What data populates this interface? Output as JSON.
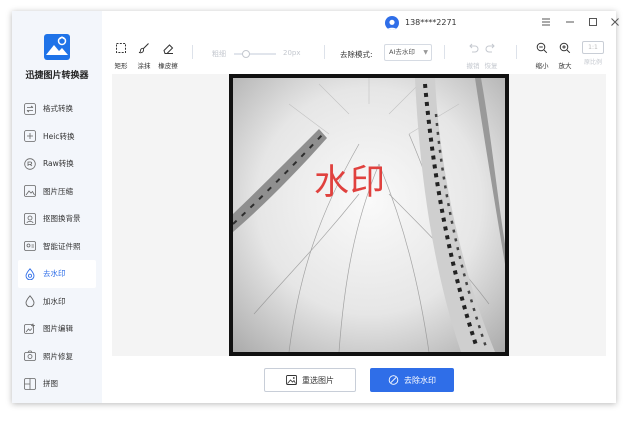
{
  "app": {
    "title": "迅捷图片转换器"
  },
  "nav": {
    "items": [
      {
        "label": "格式转换",
        "icon": "swap-icon"
      },
      {
        "label": "Heic转换",
        "icon": "heic-icon"
      },
      {
        "label": "Raw转换",
        "icon": "raw-icon"
      },
      {
        "label": "图片压缩",
        "icon": "compress-icon"
      },
      {
        "label": "抠图换背景",
        "icon": "cutout-icon"
      },
      {
        "label": "智能证件照",
        "icon": "id-photo-icon"
      },
      {
        "label": "去水印",
        "icon": "remove-watermark-icon",
        "active": true
      },
      {
        "label": "加水印",
        "icon": "add-watermark-icon"
      },
      {
        "label": "图片编辑",
        "icon": "edit-image-icon"
      },
      {
        "label": "照片修复",
        "icon": "repair-icon"
      },
      {
        "label": "拼图",
        "icon": "collage-icon"
      }
    ]
  },
  "user": {
    "phone": "138****2271"
  },
  "toolbar": {
    "rect_label": "矩形",
    "smear_label": "涂抹",
    "eraser_label": "橡皮擦",
    "thickness_label": "粗细",
    "thickness_value": "20px",
    "mode_label": "去除模式:",
    "mode_value": "AI去水印",
    "undo_label": "撤销",
    "redo_label": "恢复",
    "zoom_out_label": "缩小",
    "zoom_in_label": "放大",
    "ratio_value": "1:1",
    "original_ratio_label": "原比例"
  },
  "canvas": {
    "watermark_text": "水印"
  },
  "actions": {
    "reselect_label": "重选图片",
    "remove_label": "去除水印"
  },
  "colors": {
    "accent": "#2f6ee8",
    "watermark": "#e0413e"
  }
}
